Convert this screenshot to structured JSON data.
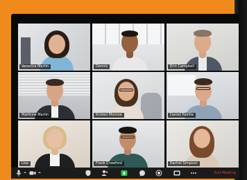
{
  "meeting": {
    "participants": [
      {
        "name": "Veronica Martin"
      },
      {
        "name": "Dennis"
      },
      {
        "name": "Erin Campbell"
      },
      {
        "name": "Matthew Martin"
      },
      {
        "name": "Kristen Monroe"
      },
      {
        "name": "Daniel Padilla"
      },
      {
        "name": "Lisa"
      },
      {
        "name": "Frank Crawford"
      },
      {
        "name": "Rachel Simpson"
      }
    ],
    "end_meeting_label": "End Meeting"
  },
  "toolbar": {
    "icons": [
      "microphone-icon",
      "video-camera-icon",
      "security-icon",
      "participants-icon",
      "share-screen-icon",
      "chat-icon",
      "record-icon",
      "reactions-icon",
      "more-icon"
    ]
  },
  "colors": {
    "frame_orange": "#f08a1c",
    "window_black": "#0a0a0a",
    "share_green": "#2fbf4a",
    "end_red": "#e8392a"
  }
}
